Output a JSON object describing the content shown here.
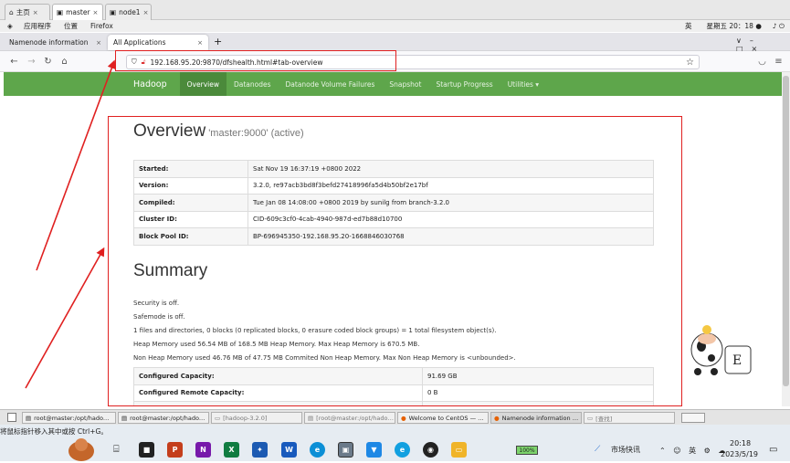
{
  "vm": {
    "tabs": [
      {
        "label": "主页"
      },
      {
        "label": "master"
      },
      {
        "label": "node1"
      }
    ]
  },
  "gnome": {
    "applications": "应用程序",
    "places": "位置",
    "firefox": "Firefox",
    "lang": "英",
    "clock": "星期五 20：18 ●"
  },
  "firefox": {
    "tabs": [
      {
        "label": "Namenode information"
      },
      {
        "label": "All Applications"
      }
    ],
    "new_tab": "+",
    "url": "192.168.95.20:9870/dfshealth.html#tab-overview"
  },
  "hadoop": {
    "brand": "Hadoop",
    "nav": [
      "Overview",
      "Datanodes",
      "Datanode Volume Failures",
      "Snapshot",
      "Startup Progress",
      "Utilities ▾"
    ],
    "overview_title": "Overview",
    "overview_sub": "'master:9000' (active)",
    "overview_rows": [
      {
        "k": "Started:",
        "v": "Sat Nov 19 16:37:19 +0800 2022"
      },
      {
        "k": "Version:",
        "v": "3.2.0, re97acb3bd8f3befd27418996fa5d4b50bf2e17bf"
      },
      {
        "k": "Compiled:",
        "v": "Tue Jan 08 14:08:00 +0800 2019 by sunilg from branch-3.2.0"
      },
      {
        "k": "Cluster ID:",
        "v": "CID-609c3cf0-4cab-4940-987d-ed7b88d10700"
      },
      {
        "k": "Block Pool ID:",
        "v": "BP-696945350-192.168.95.20-1668846030768"
      }
    ],
    "summary_title": "Summary",
    "summary_lines": [
      "Security is off.",
      "Safemode is off.",
      "1 files and directories, 0 blocks (0 replicated blocks, 0 erasure coded block groups) = 1 total filesystem object(s).",
      "Heap Memory used 56.54 MB of 168.5 MB Heap Memory. Max Heap Memory is 670.5 MB.",
      "Non Heap Memory used 46.76 MB of 47.75 MB Commited Non Heap Memory. Max Non Heap Memory is <unbounded>."
    ],
    "capacity_rows": [
      {
        "k": "Configured Capacity:",
        "v": "91.69 GB"
      },
      {
        "k": "Configured Remote Capacity:",
        "v": "0 B"
      }
    ]
  },
  "vm_taskbar": [
    {
      "label": "root@master:/opt/hado…"
    },
    {
      "label": "root@master:/opt/hado…"
    },
    {
      "label": "[hadoop-3.2.0]"
    },
    {
      "label": "[root@master:/opt/hado…"
    },
    {
      "label": "Welcome to CentOS — …"
    },
    {
      "label": "Namenode information …"
    },
    {
      "label": "[查找]"
    }
  ],
  "hint": "将鼠标指针移入其中或按 Ctrl+G。",
  "win": {
    "battery": "100%",
    "news": "市场快讯",
    "time": "20:18",
    "date": "2023/5/19"
  },
  "colors": {
    "hadoop_green": "#5ea64b",
    "annotation_red": "#e02020"
  }
}
